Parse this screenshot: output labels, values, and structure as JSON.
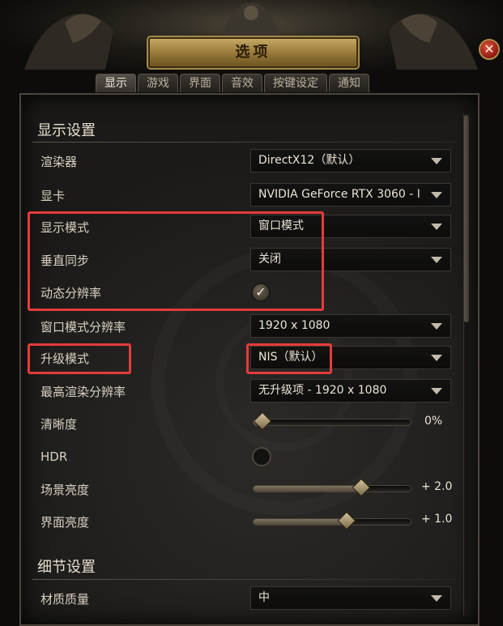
{
  "window": {
    "title": "选项",
    "close_label": "✕"
  },
  "tabs": [
    {
      "label": "显示",
      "active": true
    },
    {
      "label": "游戏",
      "active": false
    },
    {
      "label": "界面",
      "active": false
    },
    {
      "label": "音效",
      "active": false
    },
    {
      "label": "按键设定",
      "active": false
    },
    {
      "label": "通知",
      "active": false
    }
  ],
  "display_section": {
    "title": "显示设置",
    "renderer": {
      "label": "渲染器",
      "value": "DirectX12（默认）"
    },
    "gpu": {
      "label": "显卡",
      "value": "NVIDIA GeForce RTX 3060 - I"
    },
    "display_mode": {
      "label": "显示模式",
      "value": "窗口模式"
    },
    "vsync": {
      "label": "垂直同步",
      "value": "关闭"
    },
    "dynamic_resolution": {
      "label": "动态分辨率",
      "checked": true,
      "mark": "✓"
    },
    "window_resolution": {
      "label": "窗口模式分辨率",
      "value": "1920 x 1080"
    },
    "upscale_mode": {
      "label": "升级模式",
      "value": "NIS（默认）"
    },
    "max_render_resolution": {
      "label": "最高渲染分辨率",
      "value": "无升级项 - 1920 x 1080"
    },
    "sharpness": {
      "label": "清晰度",
      "value_text": "0%",
      "fraction": 0.0
    },
    "hdr": {
      "label": "HDR",
      "enabled": false
    },
    "scene_brightness": {
      "label": "场景亮度",
      "value_text": "+ 2.0",
      "fraction": 0.68
    },
    "ui_brightness": {
      "label": "界面亮度",
      "value_text": "+ 1.0",
      "fraction": 0.59
    }
  },
  "detail_section": {
    "title": "细节设置",
    "texture_quality": {
      "label": "材质质量",
      "value": "中"
    }
  },
  "colors": {
    "highlight": "#e53b3b",
    "accent_gold": "#b08a4a"
  }
}
